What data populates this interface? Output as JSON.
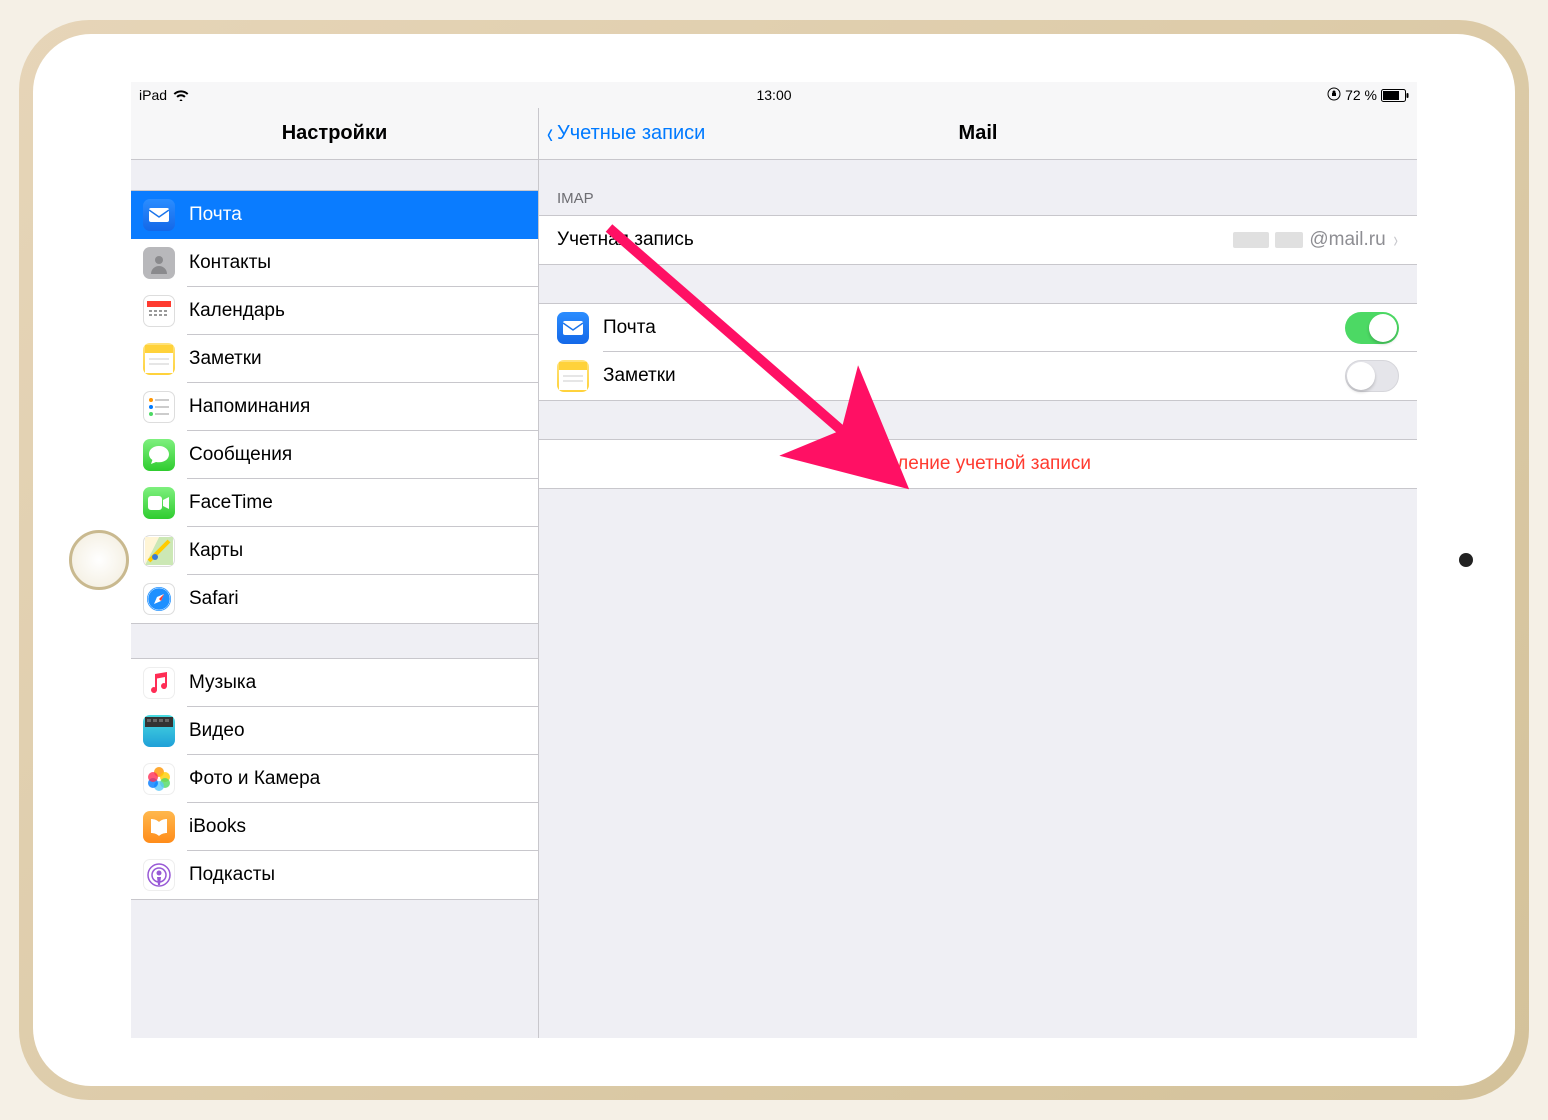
{
  "status": {
    "device": "iPad",
    "time": "13:00",
    "battery_pct": "72 %"
  },
  "sidebar": {
    "title": "Настройки",
    "group1": [
      {
        "label": "Почта",
        "icon": "mail-icon",
        "selected": true
      },
      {
        "label": "Контакты",
        "icon": "contacts-icon"
      },
      {
        "label": "Календарь",
        "icon": "calendar-icon"
      },
      {
        "label": "Заметки",
        "icon": "notes-icon"
      },
      {
        "label": "Напоминания",
        "icon": "reminders-icon"
      },
      {
        "label": "Сообщения",
        "icon": "messages-icon"
      },
      {
        "label": "FaceTime",
        "icon": "facetime-icon"
      },
      {
        "label": "Карты",
        "icon": "maps-icon"
      },
      {
        "label": "Safari",
        "icon": "safari-icon"
      }
    ],
    "group2": [
      {
        "label": "Музыка",
        "icon": "music-icon"
      },
      {
        "label": "Видео",
        "icon": "videos-icon"
      },
      {
        "label": "Фото и Камера",
        "icon": "photos-icon"
      },
      {
        "label": "iBooks",
        "icon": "ibooks-icon"
      },
      {
        "label": "Подкасты",
        "icon": "podcasts-icon"
      }
    ]
  },
  "detail": {
    "back_label": "Учетные записи",
    "title": "Mail",
    "imap_header": "IMAP",
    "account_label": "Учетная запись",
    "account_value_suffix": "@mail.ru",
    "services": {
      "mail_label": "Почта",
      "mail_on": true,
      "notes_label": "Заметки",
      "notes_on": false
    },
    "delete_label": "Удаление учетной записи"
  }
}
